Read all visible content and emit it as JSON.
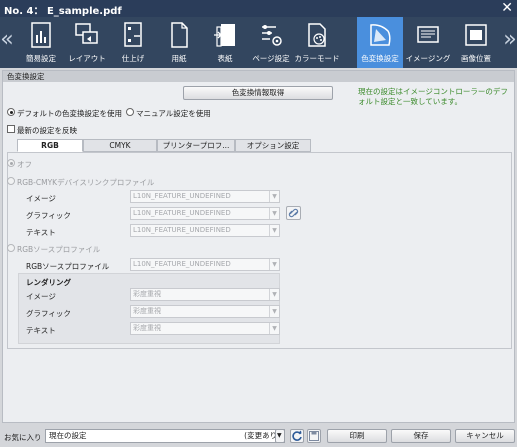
{
  "window": {
    "title": "No. 4： E_sample.pdf",
    "close": "✕"
  },
  "toolbar": {
    "items": [
      {
        "label": "簡易設定",
        "icon": "quick-setting-icon"
      },
      {
        "label": "レイアウト",
        "icon": "layout-icon"
      },
      {
        "label": "仕上げ",
        "icon": "finishing-icon"
      },
      {
        "label": "用紙",
        "icon": "paper-icon"
      },
      {
        "label": "表紙",
        "icon": "cover-icon"
      },
      {
        "label": "ページ設定",
        "icon": "page-setting-icon"
      },
      {
        "label": "カラーモード",
        "icon": "color-mode-icon"
      },
      {
        "label": "色変換設定",
        "icon": "color-conversion-icon",
        "active": true
      },
      {
        "label": "イメージング",
        "icon": "imaging-icon"
      },
      {
        "label": "画像位置",
        "icon": "image-position-icon"
      }
    ],
    "prev": "«",
    "next": "»"
  },
  "section": {
    "header": "色変換設定",
    "get_info_button": "色変換情報取得",
    "note": "現在の設定はイメージコントローラーのデフォルト設定と一致しています。",
    "radio_default": "デフォルトの色変換設定を使用",
    "radio_manual": "マニュアル設定を使用",
    "check_latest": "最新の設定を反映"
  },
  "tabs": [
    "RGB",
    "CMYK",
    "プリンタープロフ...",
    "オプション設定"
  ],
  "rgb": {
    "off": "オフ",
    "devicelink": "RGB-CMYKデバイスリンクプロファイル",
    "image_label": "イメージ",
    "image_value": "L10N_FEATURE_UNDEFINED",
    "graphic_label": "グラフィック",
    "graphic_value": "L10N_FEATURE_UNDEFINED",
    "text_label": "テキスト",
    "text_value": "L10N_FEATURE_UNDEFINED",
    "source": "RGBソースプロファイル",
    "source_label": "RGBソースプロファイル",
    "source_value": "L10N_FEATURE_UNDEFINED",
    "rendering": "レンダリング",
    "r_image_label": "イメージ",
    "r_image_value": "彩度重視",
    "r_graphic_label": "グラフィック",
    "r_graphic_value": "彩度重視",
    "r_text_label": "テキスト",
    "r_text_value": "彩度重視"
  },
  "bottom": {
    "favorites_label": "お気に入り",
    "favorites_value": "現在の設定",
    "favorites_status": "(変更あり)",
    "print": "印刷",
    "save": "保存",
    "cancel": "キャンセル"
  },
  "colors": {
    "accent": "#4a8fdd",
    "note": "#3a8a2a",
    "titlebar": "#2b3d5a"
  }
}
